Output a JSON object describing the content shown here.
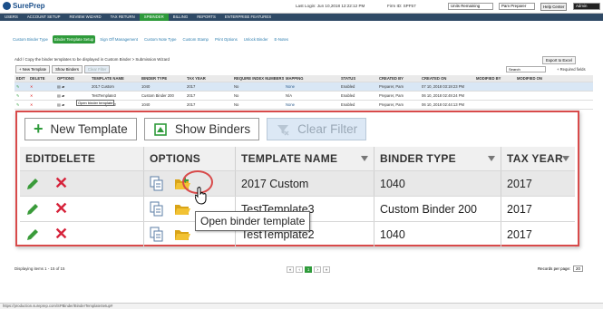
{
  "app": {
    "logo_text": "SurePrep"
  },
  "topbar": {
    "last_login": "Last Login: Jun 10,2018 12:22:12 PM",
    "firm_id": "Firm ID: SPF57",
    "units_select": "Units Remaining",
    "user_select": "Pam Preparer",
    "help_button": "Help Center",
    "admin_select": "Admin"
  },
  "nav": [
    "USERS",
    "ACCOUNT SETUP",
    "REVIEW WIZARD",
    "TAX RETURN",
    "SPBINDER",
    "BILLING",
    "REPORTS",
    "ENTERPRISE FEATURES"
  ],
  "nav_active_index": 4,
  "subnav": [
    "Custom Binder Type",
    "Binder Template Setup",
    "Sign Off Management",
    "Custom Note Type",
    "Custom Stamp",
    "Print Options",
    "Unlock Binder",
    "E-Notes"
  ],
  "subnav_active_index": 1,
  "description": "Add / Copy the binder templates to be displayed in Custom Binder > Submission Wizard",
  "export_button": "Export to Excel",
  "small_buttons": {
    "new_template": "+ New Template",
    "show_binders": "Show Binders",
    "clear_filter": "Clear Filter"
  },
  "search_placeholder": "Search",
  "required_fields": "+ Required fields",
  "bg_table": {
    "headers": [
      "EDIT",
      "DELETE",
      "OPTIONS",
      "TEMPLATE NAME",
      "BINDER TYPE",
      "TAX YEAR",
      "REQUIRE INDEX NUMBERS",
      "MAPPING",
      "STATUS",
      "CREATED BY",
      "CREATED ON",
      "MODIFIED BY",
      "MODIFIED ON"
    ],
    "rows": [
      [
        "",
        "",
        "",
        "2017 Custom",
        "1040",
        "2017",
        "No",
        "None",
        "Enabled",
        "Preparer, Pam",
        "07 10, 2018 03:19:23 PM",
        "",
        ""
      ],
      [
        "",
        "",
        "",
        "TestTemplate3",
        "Custom Binder 200",
        "2017",
        "No",
        "N/A",
        "Enabled",
        "Preparer, Pam",
        "06 10, 2018 02:49:24 PM",
        "",
        ""
      ],
      [
        "",
        "",
        "",
        "TestTemplate2",
        "1040",
        "2017",
        "No",
        "None",
        "Enabled",
        "Preparer, Pam",
        "06 10, 2018 02:44:13 PM",
        "",
        ""
      ]
    ],
    "small_tooltip": "Open binder template"
  },
  "overlay": {
    "new_template": "New Template",
    "show_binders": "Show Binders",
    "clear_filter": "Clear Filter",
    "headers": {
      "edit": "EDIT",
      "delete": "DELETE",
      "options": "OPTIONS",
      "template_name": "TEMPLATE NAME",
      "binder_type": "BINDER TYPE",
      "tax_year": "TAX YEAR"
    },
    "rows": [
      {
        "template_name": "2017 Custom",
        "binder_type": "1040",
        "tax_year": "2017"
      },
      {
        "template_name": "TestTemplate3",
        "binder_type": "Custom Binder 200",
        "tax_year": "2017"
      },
      {
        "template_name": "TestTemplate2",
        "binder_type": "1040",
        "tax_year": "2017"
      }
    ],
    "tooltip": "Open binder template"
  },
  "footer": {
    "displaying": "Displaying items 1 - 15 of 15",
    "pages": [
      "«",
      "‹",
      "1",
      "›",
      "»"
    ],
    "records_label": "Records per page:",
    "records_value": "20"
  },
  "status_url": "https://production.sureprep.com/SPBinder/BinderTemplateSetup#"
}
